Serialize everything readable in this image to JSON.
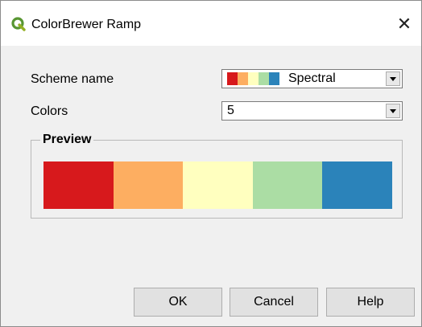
{
  "window": {
    "title": "ColorBrewer Ramp",
    "close_glyph": "✕"
  },
  "form": {
    "scheme_label": "Scheme name",
    "scheme_value": "Spectral",
    "colors_label": "Colors",
    "colors_value": "5"
  },
  "preview": {
    "title": "Preview",
    "colors": [
      "#d7191c",
      "#fdae61",
      "#ffffbf",
      "#abdda4",
      "#2b83ba"
    ]
  },
  "buttons": {
    "ok": "OK",
    "cancel": "Cancel",
    "help": "Help"
  },
  "icons": {
    "app": "qgis-logo-icon",
    "close": "close-icon",
    "dropdown": "chevron-down-icon"
  }
}
